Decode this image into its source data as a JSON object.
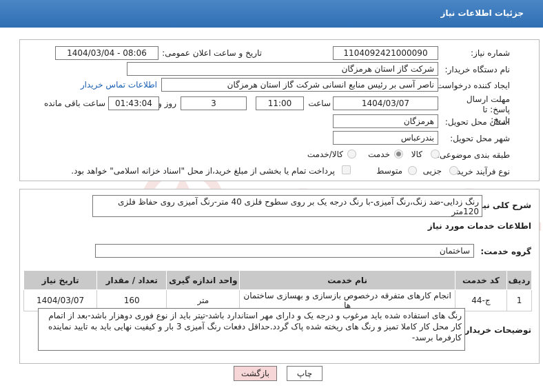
{
  "header": {
    "title": "جزئیات اطلاعات نیاز"
  },
  "fields": {
    "need_number_label": "شماره نیاز:",
    "need_number": "1104092421000090",
    "announce_label": "تاریخ و ساعت اعلان عمومی:",
    "announce_value": "1404/03/04 - 08:06",
    "buyer_label": "نام دستگاه خریدار:",
    "buyer_value": "شرکت گاز استان هرمزگان",
    "creator_label": "ایجاد کننده درخواست:",
    "creator_value": "ناصر آسی بر رئیس منابع انسانی شرکت گاز استان هرمزگان",
    "contact_link": "اطلاعات تماس خریدار",
    "deadline_label": "مهلت ارسال پاسخ: تا تاریخ:",
    "deadline_date": "1404/03/07",
    "time_label": "ساعت",
    "deadline_time": "11:00",
    "days_value": "3",
    "days_label": "روز و",
    "remaining_time": "01:43:04",
    "remaining_label": "ساعت باقی مانده",
    "province_label": "استان محل تحویل:",
    "province_value": "هرمزگان",
    "city_label": "شهر محل تحویل:",
    "city_value": "بندرعباس",
    "category_label": "طبقه بندی موضوعی:",
    "category_options": [
      "کالا",
      "خدمت",
      "کالا/خدمت"
    ],
    "category_selected": "خدمت",
    "process_label": "نوع فرآیند خرید :",
    "process_options": [
      "جزیی",
      "متوسط"
    ],
    "payment_note": "پرداخت تمام یا بخشی از مبلغ خرید،از محل \"اسناد خزانه اسلامی\" خواهد بود."
  },
  "description": {
    "label": "شرح کلی نیاز:",
    "text": "رنگ زدایی-ضد زنگ،رنگ آمیزی-با رنگ درجه یک بر روی سطوح فلزی 40 متر-رنگ آمیزی روی حفاظ فلزی 120متر"
  },
  "services": {
    "section_title": "اطلاعات خدمات مورد نیاز",
    "group_label": "گروه خدمت:",
    "group_value": "ساختمان",
    "columns": [
      "ردیف",
      "کد خدمت",
      "نام خدمت",
      "واحد اندازه گیری",
      "تعداد / مقدار",
      "تاریخ نیاز"
    ],
    "rows": [
      [
        "1",
        "ج-44",
        "انجام کارهای متفرقه درخصوص بازسازی و بهسازی ساختمان ها",
        "متر",
        "160",
        "1404/03/07"
      ]
    ]
  },
  "buyer_notes": {
    "label": "توضیحات خریدار:",
    "text": "رنگ های استفاده شده باید  مرغوب و درجه یک و دارای مهر استاندارد باشد-تیتر باید از نوع فوری دوهزار باشد-بعد از اتمام کار محل کار  کاملا تمیز و رنگ های ریخته شده پاک گردد.حداقل دفعات رنگ آمیزی 3 بار و کیفیت نهایی باید به تایید نماینده کارفرما برسد-"
  },
  "buttons": {
    "print": "چاپ",
    "back": "بازگشت"
  },
  "watermark": {
    "text": "AriaTender.neT"
  },
  "colors": {
    "header_bg": "#3a78bb",
    "link": "#1a5fb4",
    "back_button": "#f6d6d6",
    "watermark": "#c0392b"
  }
}
